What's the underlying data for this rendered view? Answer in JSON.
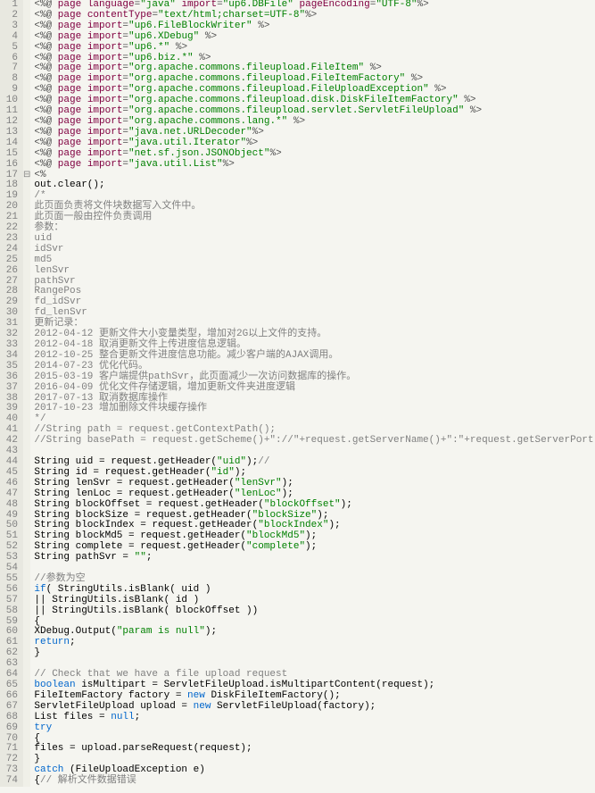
{
  "lines": [
    {
      "n": 1,
      "h": "<span class='pn'>&lt;%@ </span><span class='dir'>page </span><span class='attr'>language</span><span class='pn'>=</span><span class='str'>\"java\"</span> <span class='attr'>import</span><span class='pn'>=</span><span class='str'>\"up6.DBFile\"</span> <span class='attr'>pageEncoding</span><span class='pn'>=</span><span class='str'>\"UTF-8\"</span><span class='pn'>%&gt;</span>"
    },
    {
      "n": 2,
      "h": "<span class='pn'>&lt;%@ </span><span class='dir'>page </span><span class='attr'>contentType</span><span class='pn'>=</span><span class='str'>\"text/html;charset=UTF-8\"</span><span class='pn'>%&gt;</span>"
    },
    {
      "n": 3,
      "h": "<span class='pn'>&lt;%@ </span><span class='dir'>page </span><span class='attr'>import</span><span class='pn'>=</span><span class='str'>\"up6.FileBlockWriter\"</span> <span class='pn'>%&gt;</span>"
    },
    {
      "n": 4,
      "h": "<span class='pn'>&lt;%@ </span><span class='dir'>page </span><span class='attr'>import</span><span class='pn'>=</span><span class='str'>\"up6.XDebug\"</span> <span class='pn'>%&gt;</span>"
    },
    {
      "n": 5,
      "h": "<span class='pn'>&lt;%@ </span><span class='dir'>page </span><span class='attr'>import</span><span class='pn'>=</span><span class='str'>\"up6.*\"</span> <span class='pn'>%&gt;</span>"
    },
    {
      "n": 6,
      "h": "<span class='pn'>&lt;%@ </span><span class='dir'>page </span><span class='attr'>import</span><span class='pn'>=</span><span class='str'>\"up6.biz.*\"</span> <span class='pn'>%&gt;</span>"
    },
    {
      "n": 7,
      "h": "<span class='pn'>&lt;%@ </span><span class='dir'>page </span><span class='attr'>import</span><span class='pn'>=</span><span class='str'>\"org.apache.commons.fileupload.FileItem\"</span> <span class='pn'>%&gt;</span>"
    },
    {
      "n": 8,
      "h": "<span class='pn'>&lt;%@ </span><span class='dir'>page </span><span class='attr'>import</span><span class='pn'>=</span><span class='str'>\"org.apache.commons.fileupload.FileItemFactory\"</span> <span class='pn'>%&gt;</span>"
    },
    {
      "n": 9,
      "h": "<span class='pn'>&lt;%@ </span><span class='dir'>page </span><span class='attr'>import</span><span class='pn'>=</span><span class='str'>\"org.apache.commons.fileupload.FileUploadException\"</span> <span class='pn'>%&gt;</span>"
    },
    {
      "n": 10,
      "h": "<span class='pn'>&lt;%@ </span><span class='dir'>page </span><span class='attr'>import</span><span class='pn'>=</span><span class='str'>\"org.apache.commons.fileupload.disk.DiskFileItemFactory\"</span> <span class='pn'>%&gt;</span>"
    },
    {
      "n": 11,
      "h": "<span class='pn'>&lt;%@ </span><span class='dir'>page </span><span class='attr'>import</span><span class='pn'>=</span><span class='str'>\"org.apache.commons.fileupload.servlet.ServletFileUpload\"</span> <span class='pn'>%&gt;</span>"
    },
    {
      "n": 12,
      "h": "<span class='pn'>&lt;%@ </span><span class='dir'>page </span><span class='attr'>import</span><span class='pn'>=</span><span class='str'>\"org.apache.commons.lang.*\"</span> <span class='pn'>%&gt;</span>"
    },
    {
      "n": 13,
      "h": "<span class='pn'>&lt;%@ </span><span class='dir'>page </span><span class='attr'>import</span><span class='pn'>=</span><span class='str'>\"java.net.URLDecoder\"</span><span class='pn'>%&gt;</span>"
    },
    {
      "n": 14,
      "h": "<span class='pn'>&lt;%@ </span><span class='dir'>page </span><span class='attr'>import</span><span class='pn'>=</span><span class='str'>\"java.util.Iterator\"</span><span class='pn'>%&gt;</span>"
    },
    {
      "n": 15,
      "h": "<span class='pn'>&lt;%@ </span><span class='dir'>page </span><span class='attr'>import</span><span class='pn'>=</span><span class='str'>\"net.sf.json.JSONObject\"</span><span class='pn'>%&gt;</span>"
    },
    {
      "n": 16,
      "h": "<span class='pn'>&lt;%@ </span><span class='dir'>page </span><span class='attr'>import</span><span class='pn'>=</span><span class='str'>\"java.util.List\"</span><span class='pn'>%&gt;</span>"
    },
    {
      "n": 17,
      "h": "<span class='pn'>&lt;%</span>",
      "fold": "⊟"
    },
    {
      "n": 18,
      "h": " <span class='txt'>out.clear();</span>"
    },
    {
      "n": 19,
      "h": " <span class='cmt'>/*</span>"
    },
    {
      "n": 20,
      "h": "     <span class='cmt'>此页面负责将文件块数据写入文件中。</span>"
    },
    {
      "n": 21,
      "h": "     <span class='cmt'>此页面一般由控件负责调用</span>"
    },
    {
      "n": 22,
      "h": "     <span class='cmt'>参数：</span>"
    },
    {
      "n": 23,
      "h": "         <span class='cmt'>uid</span>"
    },
    {
      "n": 24,
      "h": "         <span class='cmt'>idSvr</span>"
    },
    {
      "n": 25,
      "h": "         <span class='cmt'>md5</span>"
    },
    {
      "n": 26,
      "h": "         <span class='cmt'>lenSvr</span>"
    },
    {
      "n": 27,
      "h": "         <span class='cmt'>pathSvr</span>"
    },
    {
      "n": 28,
      "h": "         <span class='cmt'>RangePos</span>"
    },
    {
      "n": 29,
      "h": "         <span class='cmt'>fd_idSvr</span>"
    },
    {
      "n": 30,
      "h": "         <span class='cmt'>fd_lenSvr</span>"
    },
    {
      "n": 31,
      "h": "     <span class='cmt'>更新记录：</span>"
    },
    {
      "n": 32,
      "h": "         <span class='cmt'>2012-04-12 更新文件大小变量类型，增加对2G以上文件的支持。</span>"
    },
    {
      "n": 33,
      "h": "         <span class='cmt'>2012-04-18 取消更新文件上传进度信息逻辑。</span>"
    },
    {
      "n": 34,
      "h": "         <span class='cmt'>2012-10-25 整合更新文件进度信息功能。减少客户端的AJAX调用。</span>"
    },
    {
      "n": 35,
      "h": "         <span class='cmt'>2014-07-23 优化代码。</span>"
    },
    {
      "n": 36,
      "h": "         <span class='cmt'>2015-03-19 客户端提供pathSvr，此页面减少一次访问数据库的操作。</span>"
    },
    {
      "n": 37,
      "h": "         <span class='cmt'>2016-04-09 优化文件存储逻辑，增加更新文件夹进度逻辑</span>"
    },
    {
      "n": 38,
      "h": "         <span class='cmt'>2017-07-13 取消数据库操作</span>"
    },
    {
      "n": 39,
      "h": "         <span class='cmt'>2017-10-23 增加删除文件块缓存操作</span>"
    },
    {
      "n": 40,
      "h": " <span class='cmt'>*/</span>"
    },
    {
      "n": 41,
      "h": " <span class='cmt'>//String path = request.getContextPath();</span>"
    },
    {
      "n": 42,
      "h": " <span class='cmt'>//String basePath = request.getScheme()+\"://\"+request.getServerName()+\":\"+request.getServerPort()+path+\"/\";</span>"
    },
    {
      "n": 43,
      "h": ""
    },
    {
      "n": 44,
      "h": " <span class='txt'>String uid         = request.getHeader(</span><span class='str'>\"uid\"</span><span class='txt'>);</span><span class='cmt'>//</span>"
    },
    {
      "n": 45,
      "h": " <span class='txt'>String id          = request.getHeader(</span><span class='str'>\"id\"</span><span class='txt'>);</span>"
    },
    {
      "n": 46,
      "h": " <span class='txt'>String lenSvr      = request.getHeader(</span><span class='str'>\"lenSvr\"</span><span class='txt'>);</span>"
    },
    {
      "n": 47,
      "h": " <span class='txt'>String lenLoc      = request.getHeader(</span><span class='str'>\"lenLoc\"</span><span class='txt'>);</span>"
    },
    {
      "n": 48,
      "h": " <span class='txt'>String blockOffset = request.getHeader(</span><span class='str'>\"blockOffset\"</span><span class='txt'>);</span>"
    },
    {
      "n": 49,
      "h": " <span class='txt'>String blockSize   = request.getHeader(</span><span class='str'>\"blockSize\"</span><span class='txt'>);</span>"
    },
    {
      "n": 50,
      "h": " <span class='txt'>String blockIndex  = request.getHeader(</span><span class='str'>\"blockIndex\"</span><span class='txt'>);</span>"
    },
    {
      "n": 51,
      "h": " <span class='txt'>String blockMd5    = request.getHeader(</span><span class='str'>\"blockMd5\"</span><span class='txt'>);</span>"
    },
    {
      "n": 52,
      "h": " <span class='txt'>String complete    = request.getHeader(</span><span class='str'>\"complete\"</span><span class='txt'>);</span>"
    },
    {
      "n": 53,
      "h": " <span class='txt'>String pathSvr     = </span><span class='str'>\"\"</span><span class='txt'>;</span>"
    },
    {
      "n": 54,
      "h": ""
    },
    {
      "n": 55,
      "h": " <span class='cmt'>//参数为空</span>"
    },
    {
      "n": 56,
      "h": " <span class='kw'>if</span><span class='txt'>(  StringUtils.isBlank( uid )</span>"
    },
    {
      "n": 57,
      "h": "     <span class='txt'>|| StringUtils.isBlank( id )</span>"
    },
    {
      "n": 58,
      "h": "     <span class='txt'>|| StringUtils.isBlank( blockOffset ))</span>"
    },
    {
      "n": 59,
      "h": " <span class='txt'>{</span>"
    },
    {
      "n": 60,
      "h": "     <span class='txt'>XDebug.Output(</span><span class='str'>\"param is null\"</span><span class='txt'>);</span>"
    },
    {
      "n": 61,
      "h": "     <span class='kw'>return</span><span class='txt'>;</span>"
    },
    {
      "n": 62,
      "h": " <span class='txt'>}</span>"
    },
    {
      "n": 63,
      "h": ""
    },
    {
      "n": 64,
      "h": " <span class='cmt'>// Check that we have a file upload request</span>"
    },
    {
      "n": 65,
      "h": " <span class='kw'>boolean</span><span class='txt'> isMultipart = ServletFileUpload.isMultipartContent(request);</span>"
    },
    {
      "n": 66,
      "h": " <span class='txt'>FileItemFactory factory = </span><span class='kw'>new</span><span class='txt'> DiskFileItemFactory();  </span>"
    },
    {
      "n": 67,
      "h": " <span class='txt'>ServletFileUpload upload = </span><span class='kw'>new</span><span class='txt'> ServletFileUpload(factory);</span>"
    },
    {
      "n": 68,
      "h": " <span class='txt'>List files = </span><span class='kw'>null</span><span class='txt'>;</span>"
    },
    {
      "n": 69,
      "h": " <span class='kw'>try</span>"
    },
    {
      "n": 70,
      "h": " <span class='txt'>{</span>"
    },
    {
      "n": 71,
      "h": "     <span class='txt'>files = upload.parseRequest(request);</span>"
    },
    {
      "n": 72,
      "h": " <span class='txt'>}</span>"
    },
    {
      "n": 73,
      "h": " <span class='kw'>catch</span><span class='txt'> (FileUploadException e)</span>"
    },
    {
      "n": 74,
      "h": " <span class='txt'>{</span><span class='cmt'>// 解析文件数据错误  </span>"
    }
  ]
}
